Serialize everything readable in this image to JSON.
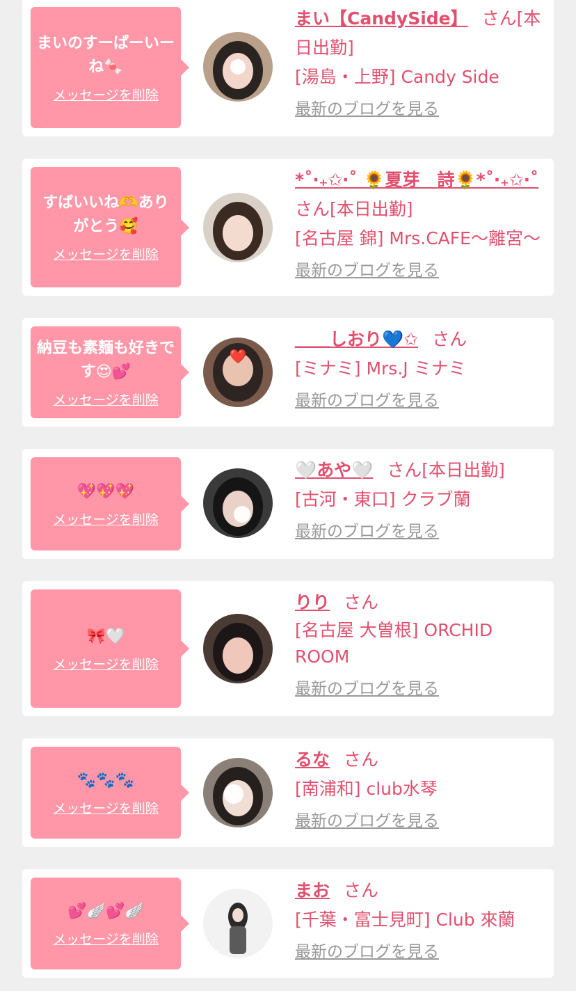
{
  "common": {
    "delete_label": "メッセージを削除",
    "blog_label": "最新のブログを見る"
  },
  "cards": [
    {
      "message": "まいのすーぱーいーね🍬",
      "name": "まい【CandySide】",
      "suffix": "さん[本日出勤]",
      "shop": "[湯島・上野] Candy Side",
      "avatar_colors": [
        "#b8a08a",
        "#2a2420",
        "#f2d6cc"
      ]
    },
    {
      "message": "すばいいね🫶ありがとう🥰",
      "name": "*˚‧₊✩‧˚ 🌻夏芽　詩🌻*˚‧₊✩‧˚",
      "suffix": "さん[本日出勤]",
      "shop": "[名古屋 錦] Mrs.CAFE〜離宮〜",
      "avatar_colors": [
        "#d9d0c8",
        "#3a2a22",
        "#f3dccf"
      ]
    },
    {
      "message": "納豆も素麺も好きです😍💕",
      "name": "＿＿しおり💙✩",
      "suffix": "さん",
      "shop": "[ミナミ] Mrs.J ミナミ",
      "avatar_colors": [
        "#7a5a4a",
        "#2e2522",
        "#e8c3b0"
      ]
    },
    {
      "message": "💖💖💖",
      "name": "🤍あや🤍",
      "suffix": "さん[本日出勤]",
      "shop": "[古河・東口] クラブ蘭",
      "avatar_colors": [
        "#3a3a3a",
        "#151515",
        "#ead2c8"
      ]
    },
    {
      "message": "🎀🤍",
      "name": "りり",
      "suffix": "さん",
      "shop": "[名古屋 大曽根] ORCHID ROOM",
      "avatar_colors": [
        "#4a3a34",
        "#1c1716",
        "#efc8bb"
      ]
    },
    {
      "message": "🐾🐾🐾",
      "name": "るな",
      "suffix": "さん",
      "shop": "[南浦和] club水琴",
      "avatar_colors": [
        "#8a8078",
        "#25201d",
        "#f0ddd4"
      ]
    },
    {
      "message": "💕🪽💕🪽",
      "name": "まお",
      "suffix": "さん",
      "shop": "[千葉・富士見町] Club 來蘭",
      "avatar_colors": [
        "#f2f2f2",
        "#2a2a2a",
        "#f2ddd2"
      ]
    }
  ]
}
